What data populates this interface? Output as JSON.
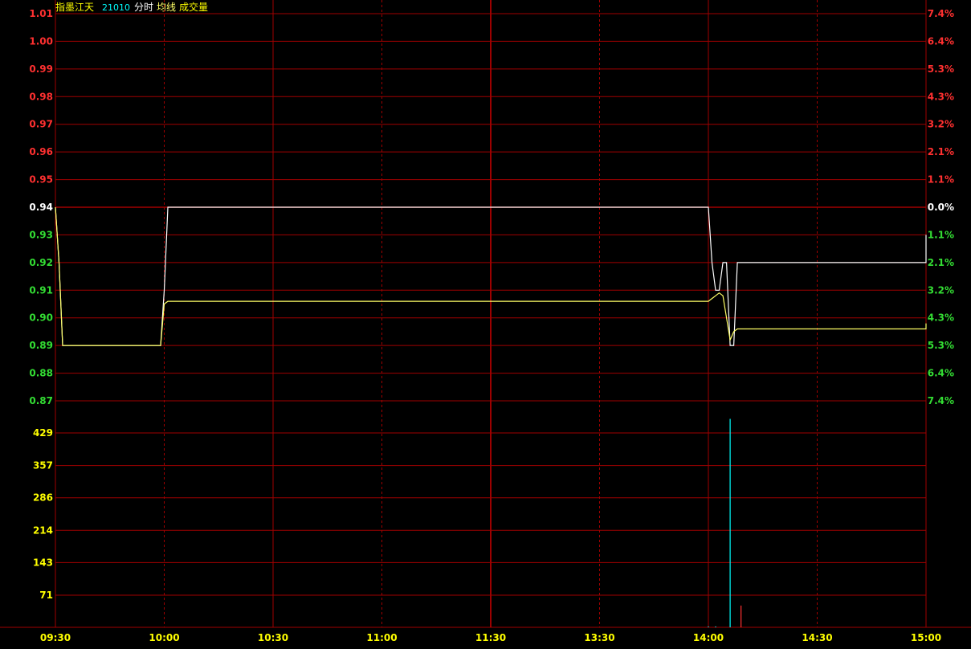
{
  "header": {
    "name": "指墨江天",
    "code": "21010",
    "legend": [
      "分时",
      "均线",
      "成交量"
    ]
  },
  "colors": {
    "background": "#000000",
    "grid": "#a00000",
    "grid_dash": "#a00000",
    "center_line": "#d00000",
    "price_line": "#ffffff",
    "avg_line": "#ffff66",
    "up": "#ff3030",
    "down": "#33dd33",
    "flat": "#ffffff",
    "volume_label": "#ffff00",
    "volume_bar": "#00ffff",
    "volume_bar_up": "#ff3030",
    "time_label": "#ffff00",
    "title": "#ffff00",
    "code": "#00ffff"
  },
  "chart_data": {
    "type": "line",
    "prev_close": 0.94,
    "price_axis": {
      "ylim": [
        0.87,
        1.01
      ],
      "left_ticks": [
        "1.01",
        "1.00",
        "0.99",
        "0.98",
        "0.97",
        "0.96",
        "0.95",
        "0.94",
        "0.93",
        "0.92",
        "0.91",
        "0.90",
        "0.89",
        "0.88",
        "0.87"
      ],
      "right_ticks": [
        "7.4%",
        "6.4%",
        "5.3%",
        "4.3%",
        "3.2%",
        "2.1%",
        "1.1%",
        "0.0%",
        "1.1%",
        "2.1%",
        "3.2%",
        "4.3%",
        "5.3%",
        "6.4%",
        "7.4%"
      ]
    },
    "volume_axis": {
      "ylim": [
        0,
        500
      ],
      "ticks": [
        "429",
        "357",
        "286",
        "214",
        "143",
        "71"
      ]
    },
    "time_ticks": [
      "09:30",
      "10:00",
      "10:30",
      "11:00",
      "11:30",
      "13:30",
      "14:00",
      "14:30",
      "15:00"
    ],
    "total_minutes": 240,
    "series": [
      {
        "key": "price",
        "x": [
          0,
          1,
          2,
          29,
          30,
          31,
          180,
          181,
          182,
          183,
          184,
          185,
          186,
          187,
          188,
          189,
          190,
          240,
          241
        ],
        "y": [
          0.94,
          0.92,
          0.89,
          0.89,
          0.91,
          0.94,
          0.94,
          0.92,
          0.91,
          0.91,
          0.92,
          0.92,
          0.89,
          0.89,
          0.92,
          0.92,
          0.92,
          0.92,
          0.93
        ]
      },
      {
        "key": "avg",
        "x": [
          0,
          1,
          2,
          29,
          30,
          31,
          180,
          181,
          182,
          183,
          184,
          185,
          186,
          187,
          188,
          189,
          190,
          240,
          241
        ],
        "y": [
          0.94,
          0.92,
          0.89,
          0.89,
          0.905,
          0.906,
          0.906,
          0.907,
          0.908,
          0.909,
          0.908,
          0.9,
          0.892,
          0.895,
          0.896,
          0.896,
          0.896,
          0.896,
          0.898
        ]
      }
    ],
    "volume": [
      {
        "x": 180,
        "v": 2,
        "dir": "down"
      },
      {
        "x": 182,
        "v": 2,
        "dir": "down"
      },
      {
        "x": 186,
        "v": 460,
        "dir": "down"
      },
      {
        "x": 189,
        "v": 48,
        "dir": "up"
      }
    ]
  }
}
